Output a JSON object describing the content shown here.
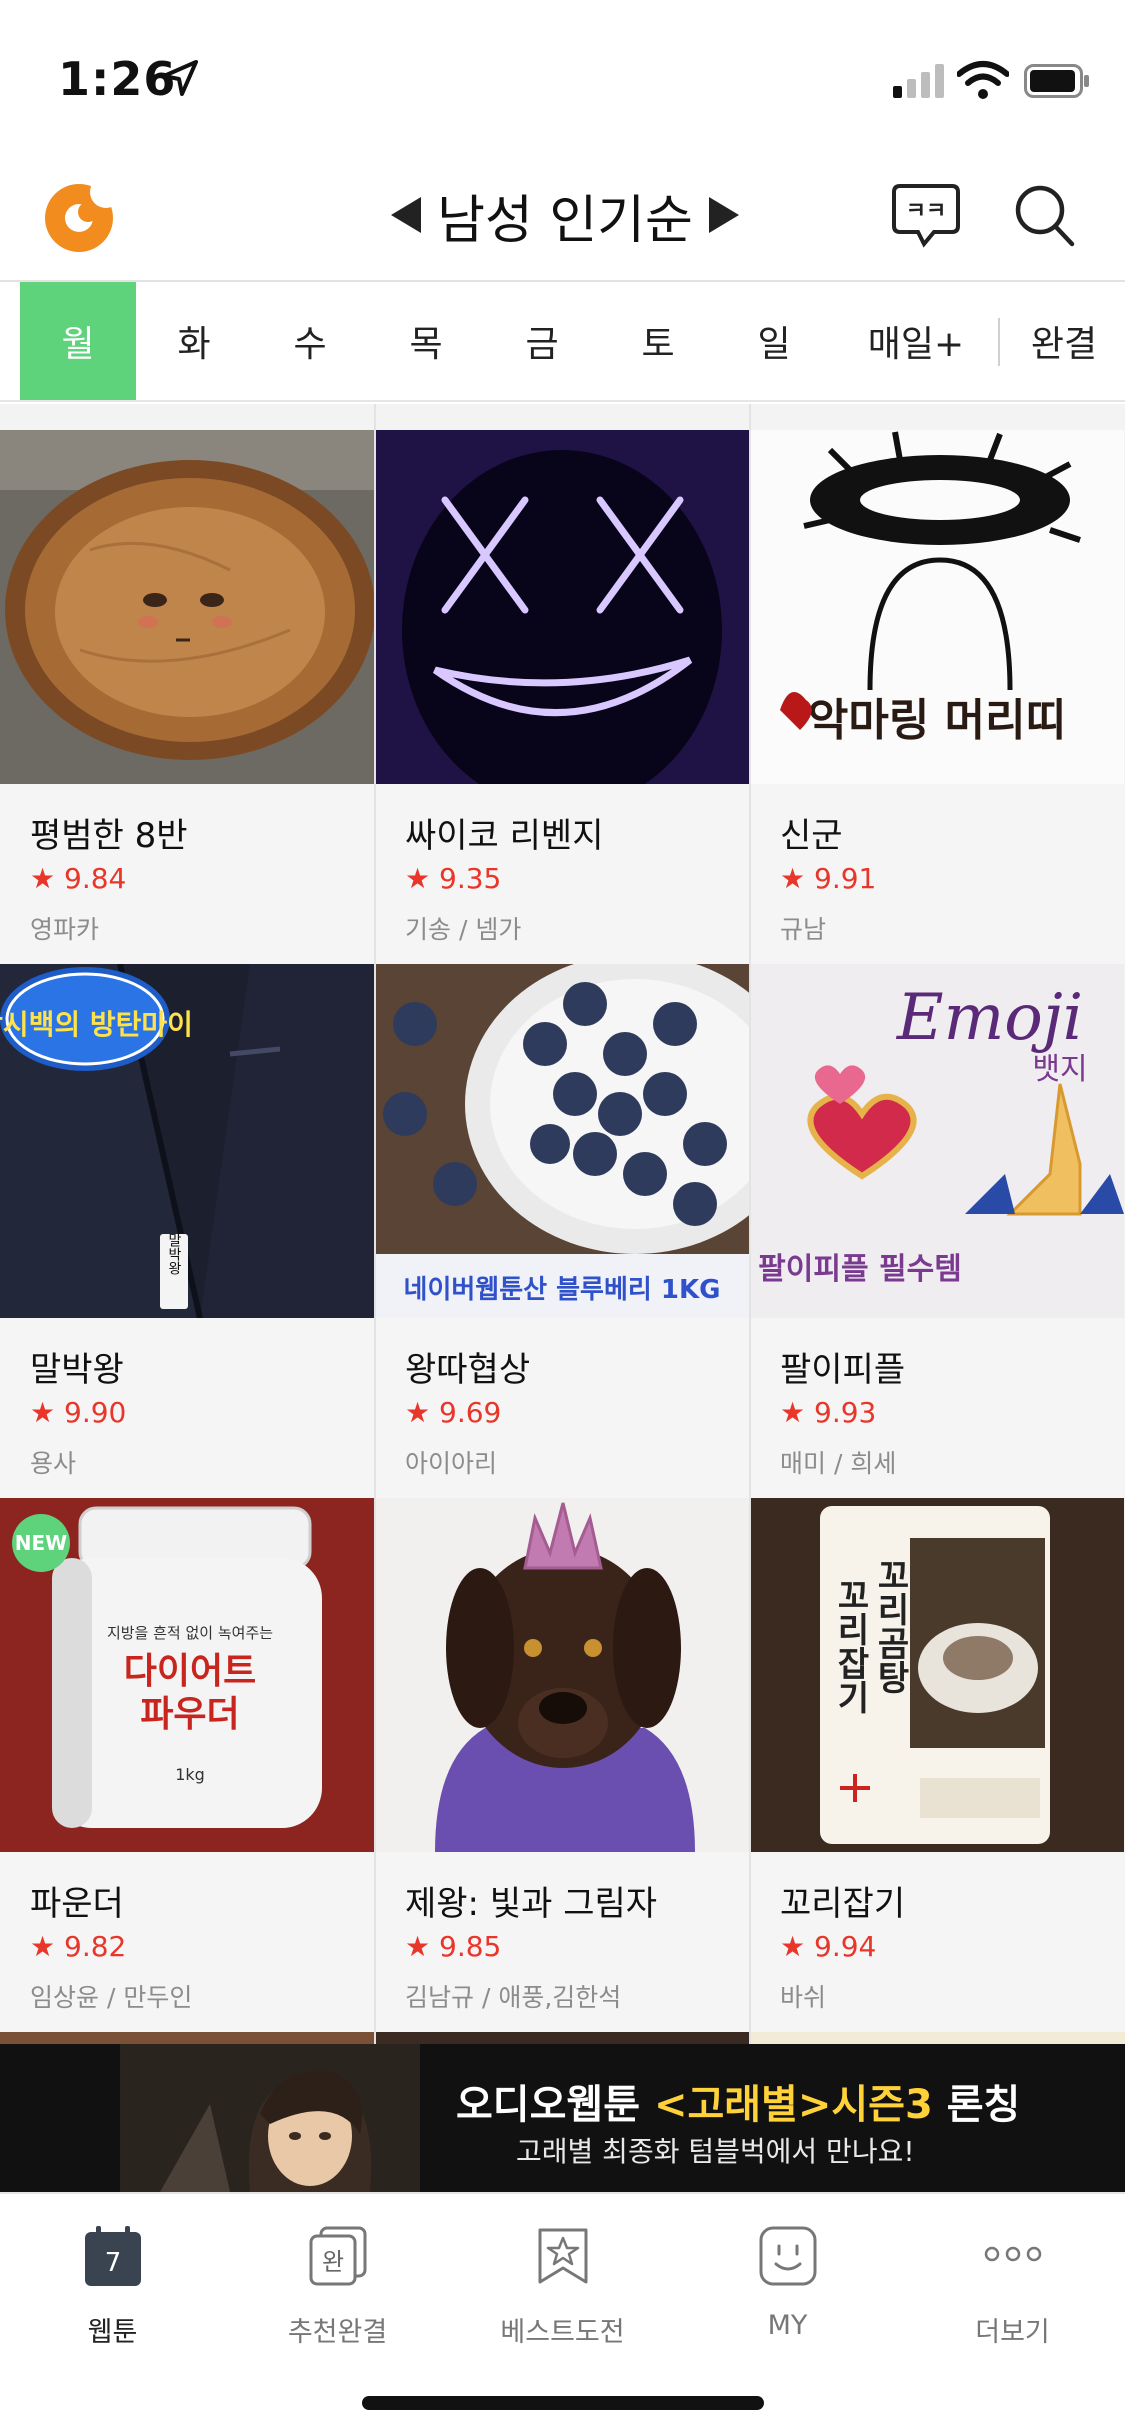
{
  "status_bar": {
    "time": "1:26"
  },
  "header": {
    "title": "남성 인기순",
    "chat_icon_text": "ㅋㅋ"
  },
  "tabs": [
    {
      "label": "월",
      "active": true
    },
    {
      "label": "화"
    },
    {
      "label": "수"
    },
    {
      "label": "목"
    },
    {
      "label": "금"
    },
    {
      "label": "토"
    },
    {
      "label": "일"
    },
    {
      "label": "매일+"
    },
    {
      "label": "완결"
    }
  ],
  "cards": [
    {
      "title": "평범한 8반",
      "rating": "9.84",
      "author": "영파카"
    },
    {
      "title": "싸이코 리벤지",
      "rating": "9.35",
      "author": "기송 / 넴가"
    },
    {
      "title": "신군",
      "rating": "9.91",
      "author": "규남"
    },
    {
      "title": "말박왕",
      "rating": "9.90",
      "author": "용사"
    },
    {
      "title": "왕따협상",
      "rating": "9.69",
      "author": "아이아리"
    },
    {
      "title": "팔이피플",
      "rating": "9.93",
      "author": "매미 / 희세"
    },
    {
      "title": "파운더",
      "rating": "9.82",
      "author": "임상윤 / 만두인",
      "badge": "NEW"
    },
    {
      "title": "제왕: 빛과 그림자",
      "rating": "9.85",
      "author": "김남규 / 애풍,김한석"
    },
    {
      "title": "꼬리잡기",
      "rating": "9.94",
      "author": "바쉬"
    }
  ],
  "thumb_text": {
    "c3": "악마링 머리띠",
    "c4": "박시백의 방탄마이",
    "c4_tag": "말박왕",
    "c5": "네이버웹툰산 블루베리 1KG",
    "c6_title": "Emoji",
    "c6_sub": "뱃지",
    "c6_caption": "팔이피플 필수템",
    "c7_small": "지방을 흔적 없이 녹여주는",
    "c7_line1": "다이어트",
    "c7_line2": "파우더",
    "c7_kg": "1kg",
    "c9_a": "꼬리잡기",
    "c9_b": "꼬리곰탕"
  },
  "star": "★",
  "banner": {
    "main_prefix": "오디오웹툰 ",
    "main_highlight": "<고래별>시즌3",
    "main_suffix": " 론칭",
    "sub": "고래별 최종화 텀블벅에서 만나요!"
  },
  "bottom_nav": [
    {
      "label": "웹툰",
      "active": true,
      "icon_text": "7"
    },
    {
      "label": "추천완결",
      "icon_text": "완"
    },
    {
      "label": "베스트도전"
    },
    {
      "label": "MY"
    },
    {
      "label": "더보기"
    }
  ],
  "colors": {
    "accent": "#5fd27c",
    "rating": "#e8362a",
    "banner_highlight": "#ffd23a"
  }
}
